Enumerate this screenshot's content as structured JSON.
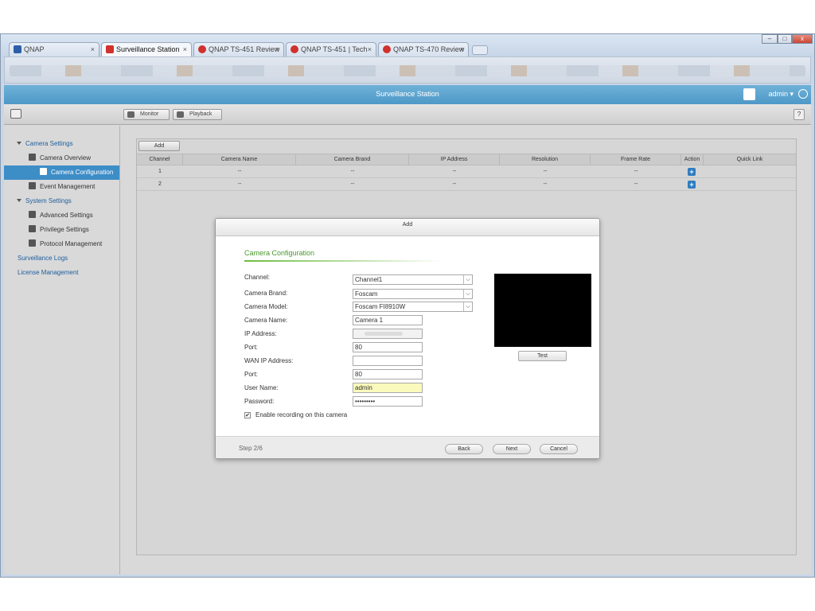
{
  "browser": {
    "tabs": [
      {
        "label": "QNAP",
        "icon": "qnap-icon"
      },
      {
        "label": "Surveillance Station",
        "icon": "surveillance-icon"
      },
      {
        "label": "QNAP TS-451 Review",
        "icon": "opera-icon"
      },
      {
        "label": "QNAP TS-451 | Tech",
        "icon": "opera-icon"
      },
      {
        "label": "QNAP TS-470 Review",
        "icon": "opera-icon"
      }
    ],
    "tab_close": "×",
    "window_controls": {
      "minimize": "–",
      "maximize": "□",
      "close": "x"
    }
  },
  "app": {
    "title": "Surveillance Station",
    "user": "admin",
    "user_caret": "▾"
  },
  "toolbar": {
    "monitor_label": "Monitor",
    "playback_label": "Playback",
    "help_label": "?"
  },
  "sidebar": {
    "camera_settings": "Camera Settings",
    "camera_overview": "Camera Overview",
    "camera_configuration": "Camera Configuration",
    "event_management": "Event Management",
    "system_settings": "System Settings",
    "advanced_settings": "Advanced Settings",
    "privilege_settings": "Privilege Settings",
    "protocol_management": "Protocol Management",
    "surveillance_logs": "Surveillance Logs",
    "license_management": "License Management"
  },
  "table": {
    "add_label": "Add",
    "columns": [
      "Channel",
      "Camera Name",
      "Camera Brand",
      "IP Address",
      "Resolution",
      "Frame Rate",
      "Action",
      "Quick Link"
    ],
    "rows": [
      [
        "1",
        "--",
        "--",
        "--",
        "--",
        "--"
      ],
      [
        "2",
        "--",
        "--",
        "--",
        "--",
        "--"
      ]
    ]
  },
  "dialog": {
    "title": "Add",
    "section": "Camera Configuration",
    "labels": {
      "channel": "Channel:",
      "brand": "Camera Brand:",
      "model": "Camera Model:",
      "name": "Camera Name:",
      "ip": "IP Address:",
      "port": "Port:",
      "wan_ip": "WAN IP Address:",
      "wan_port": "Port:",
      "username": "User Name:",
      "password": "Password:"
    },
    "values": {
      "channel": "Channel1",
      "brand": "Foscam",
      "model": "Foscam FI8910W",
      "name": "Camera 1",
      "ip": "",
      "port": "80",
      "wan_ip": "",
      "wan_port": "80",
      "username": "admin",
      "password": "•••••••••"
    },
    "enable_recording": "Enable recording on this camera",
    "checkbox_mark": "✔",
    "test_label": "Test",
    "step": "Step 2/6",
    "back_label": "Back",
    "next_label": "Next",
    "cancel_label": "Cancel"
  },
  "colors": {
    "header_blue": "#4d98c8",
    "selected_blue": "#3d8dc7",
    "section_green": "#4a9a2e"
  }
}
